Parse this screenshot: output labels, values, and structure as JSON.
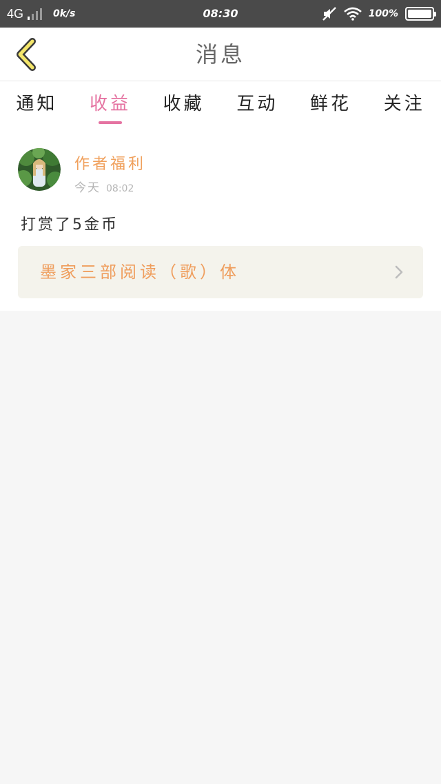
{
  "status_bar": {
    "network": "4G",
    "speed": "0k/s",
    "time": "08:30",
    "battery_percent": "100",
    "battery_level": 1.0
  },
  "header": {
    "title": "消息"
  },
  "tabs": [
    {
      "label": "通知",
      "active": false
    },
    {
      "label": "收益",
      "active": true
    },
    {
      "label": "收藏",
      "active": false
    },
    {
      "label": "互动",
      "active": false
    },
    {
      "label": "鲜花",
      "active": false
    },
    {
      "label": "关注",
      "active": false
    }
  ],
  "message": {
    "author": "作者福利",
    "time_day": "今天",
    "time_clock": "08:02",
    "body": "打赏了5金币",
    "book_title": "墨家三部阅读（歌）体"
  },
  "colors": {
    "accent_pink": "#e573a1",
    "accent_orange": "#f0a05c",
    "status_bar_bg": "#4a4a4a",
    "link_bg": "#f4f3ec"
  },
  "icons": {
    "back": "chevron-left-icon",
    "book_link": "chevron-right-icon",
    "mute": "mute-icon",
    "wifi": "wifi-icon",
    "battery": "battery-icon",
    "signal": "signal-icon"
  }
}
